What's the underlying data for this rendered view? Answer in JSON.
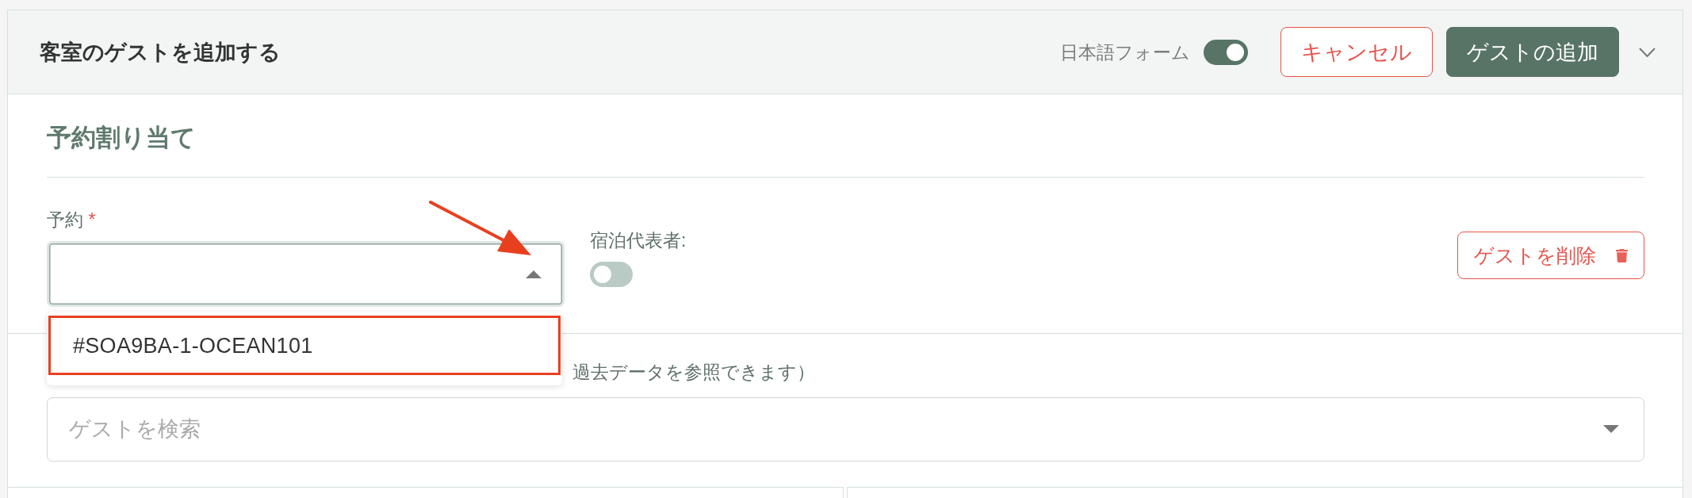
{
  "header": {
    "title": "客室のゲストを追加する",
    "language_toggle": {
      "label": "日本語フォーム",
      "on": true
    },
    "buttons": [
      {
        "label": "キャンセル",
        "kind": "outline"
      },
      {
        "label": "ゲストの追加",
        "kind": "primary"
      }
    ]
  },
  "reservation_section": {
    "title": "予約割り当て",
    "reservation_field": {
      "label": "予約",
      "required_mark": "*",
      "expanded": true,
      "arrow_annotation": true,
      "options": [
        {
          "label": "#SOA9BA-1-OCEAN101",
          "selected": false,
          "annotated": true
        }
      ]
    },
    "primary_guest": {
      "label": "宿泊代表者:",
      "on": false
    },
    "remove_button": {
      "label": "ゲストを削除"
    }
  },
  "guest_search": {
    "label": "過去データを参照できます）",
    "placeholder": "ゲストを検索",
    "expanded": false
  }
}
